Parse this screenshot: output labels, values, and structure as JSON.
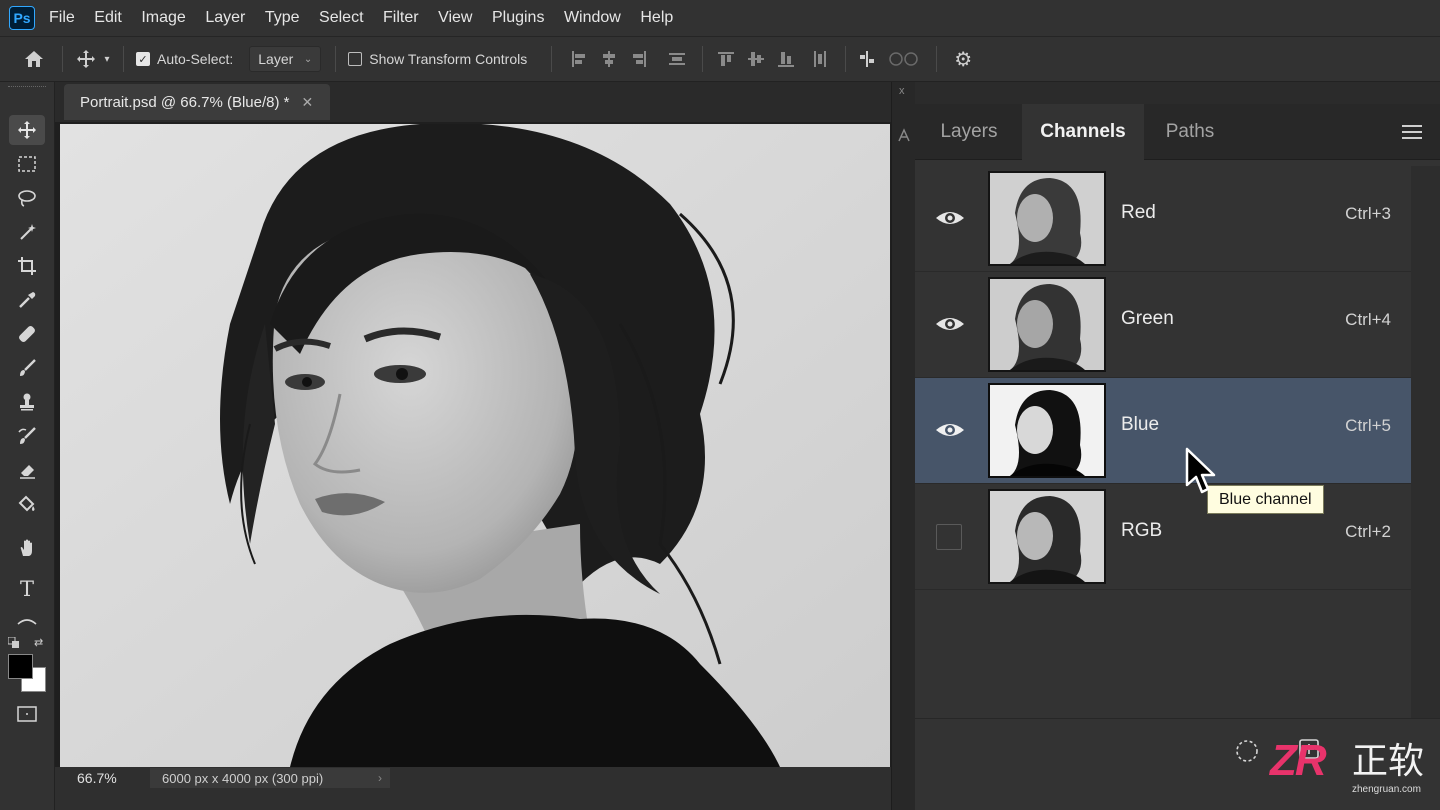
{
  "app": {
    "logo_text": "Ps"
  },
  "menu": [
    "File",
    "Edit",
    "Image",
    "Layer",
    "Type",
    "Select",
    "Filter",
    "View",
    "Plugins",
    "Window",
    "Help"
  ],
  "options_bar": {
    "auto_select_label": "Auto-Select:",
    "auto_select_checked": true,
    "auto_select_target": "Layer",
    "show_transform_label": "Show Transform Controls",
    "show_transform_checked": false
  },
  "tools": [
    "move-tool",
    "marquee-tool",
    "lasso-tool",
    "magic-wand-tool",
    "crop-tool",
    "eyedropper-tool",
    "healing-tool",
    "brush-tool",
    "clone-stamp-tool",
    "history-brush-tool",
    "eraser-tool",
    "paint-bucket-tool",
    "hand-tool",
    "type-tool",
    "path-selection-tool"
  ],
  "tool_glyphs": {
    "type_tool": "T"
  },
  "document": {
    "tab_title": "Portrait.psd @ 66.7% (Blue/8) *",
    "close_glyph": "✕",
    "zoom": "66.7%",
    "info": "6000 px x 4000 px (300 ppi)"
  },
  "mini_dock": {
    "close_glyph": "x"
  },
  "panel": {
    "tabs": [
      "Layers",
      "Channels",
      "Paths"
    ],
    "active_tab": "Channels",
    "channels": [
      {
        "name": "Red",
        "shortcut": "Ctrl+3",
        "visible": true,
        "selected": false
      },
      {
        "name": "Green",
        "shortcut": "Ctrl+4",
        "visible": true,
        "selected": false
      },
      {
        "name": "Blue",
        "shortcut": "Ctrl+5",
        "visible": true,
        "selected": true
      },
      {
        "name": "RGB",
        "shortcut": "Ctrl+2",
        "visible": false,
        "selected": false
      }
    ]
  },
  "tooltip": "Blue channel",
  "watermark": {
    "logo": "ZR",
    "chinese": "正软",
    "domain": "zhengruan.com"
  },
  "colors": {
    "selected_row": "#475569",
    "ps_blue": "#31a8ff",
    "watermark_pink": "#e8336b"
  }
}
